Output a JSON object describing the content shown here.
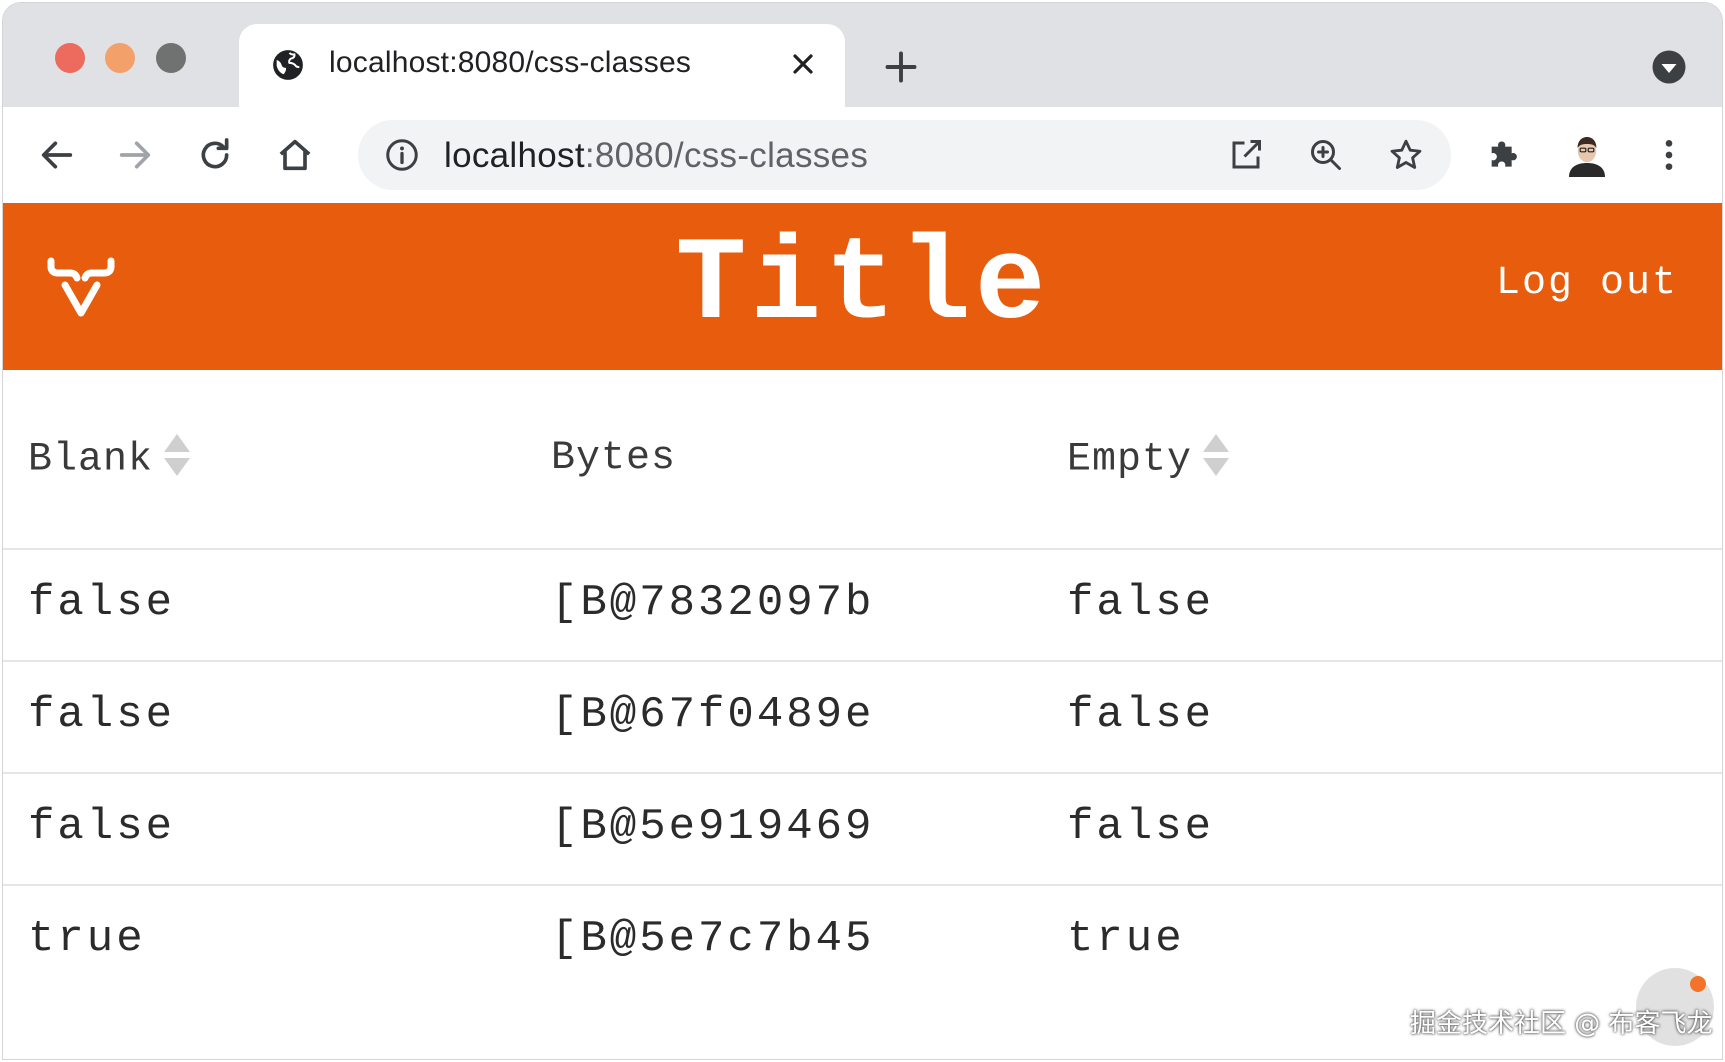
{
  "browser": {
    "tab": {
      "title": "localhost:8080/css-classes"
    },
    "omnibox": {
      "host": "localhost",
      "rest": ":8080/css-classes"
    }
  },
  "app": {
    "title": "Title",
    "logout_label": "Log out",
    "accent_color": "#e85c0d"
  },
  "grid": {
    "columns": [
      {
        "label": "Blank",
        "sortable": true
      },
      {
        "label": "Bytes",
        "sortable": false
      },
      {
        "label": "Empty",
        "sortable": true
      }
    ],
    "rows": [
      [
        "false",
        "[B@7832097b",
        "false"
      ],
      [
        "false",
        "[B@67f0489e",
        "false"
      ],
      [
        "false",
        "[B@5e919469",
        "false"
      ],
      [
        "true",
        "[B@5e7c7b45",
        "true"
      ]
    ]
  },
  "watermark": {
    "text": "掘金技术社区 @ 布客飞龙"
  },
  "icons": {
    "tab_favicon": "globe-icon",
    "tab_close": "close-icon",
    "new_tab": "plus-icon",
    "tab_search": "chevron-down-circle-icon",
    "back": "arrow-left-icon",
    "forward": "arrow-right-icon",
    "reload": "reload-icon",
    "home": "home-icon",
    "site_info": "info-icon",
    "open_in": "open-external-icon",
    "zoom": "zoom-in-icon",
    "bookmark": "star-icon",
    "extensions": "puzzle-icon",
    "profile": "avatar",
    "menu": "kebab-menu-icon",
    "app_logo": "vaadin-logo-icon",
    "sort": "sort-icon"
  }
}
